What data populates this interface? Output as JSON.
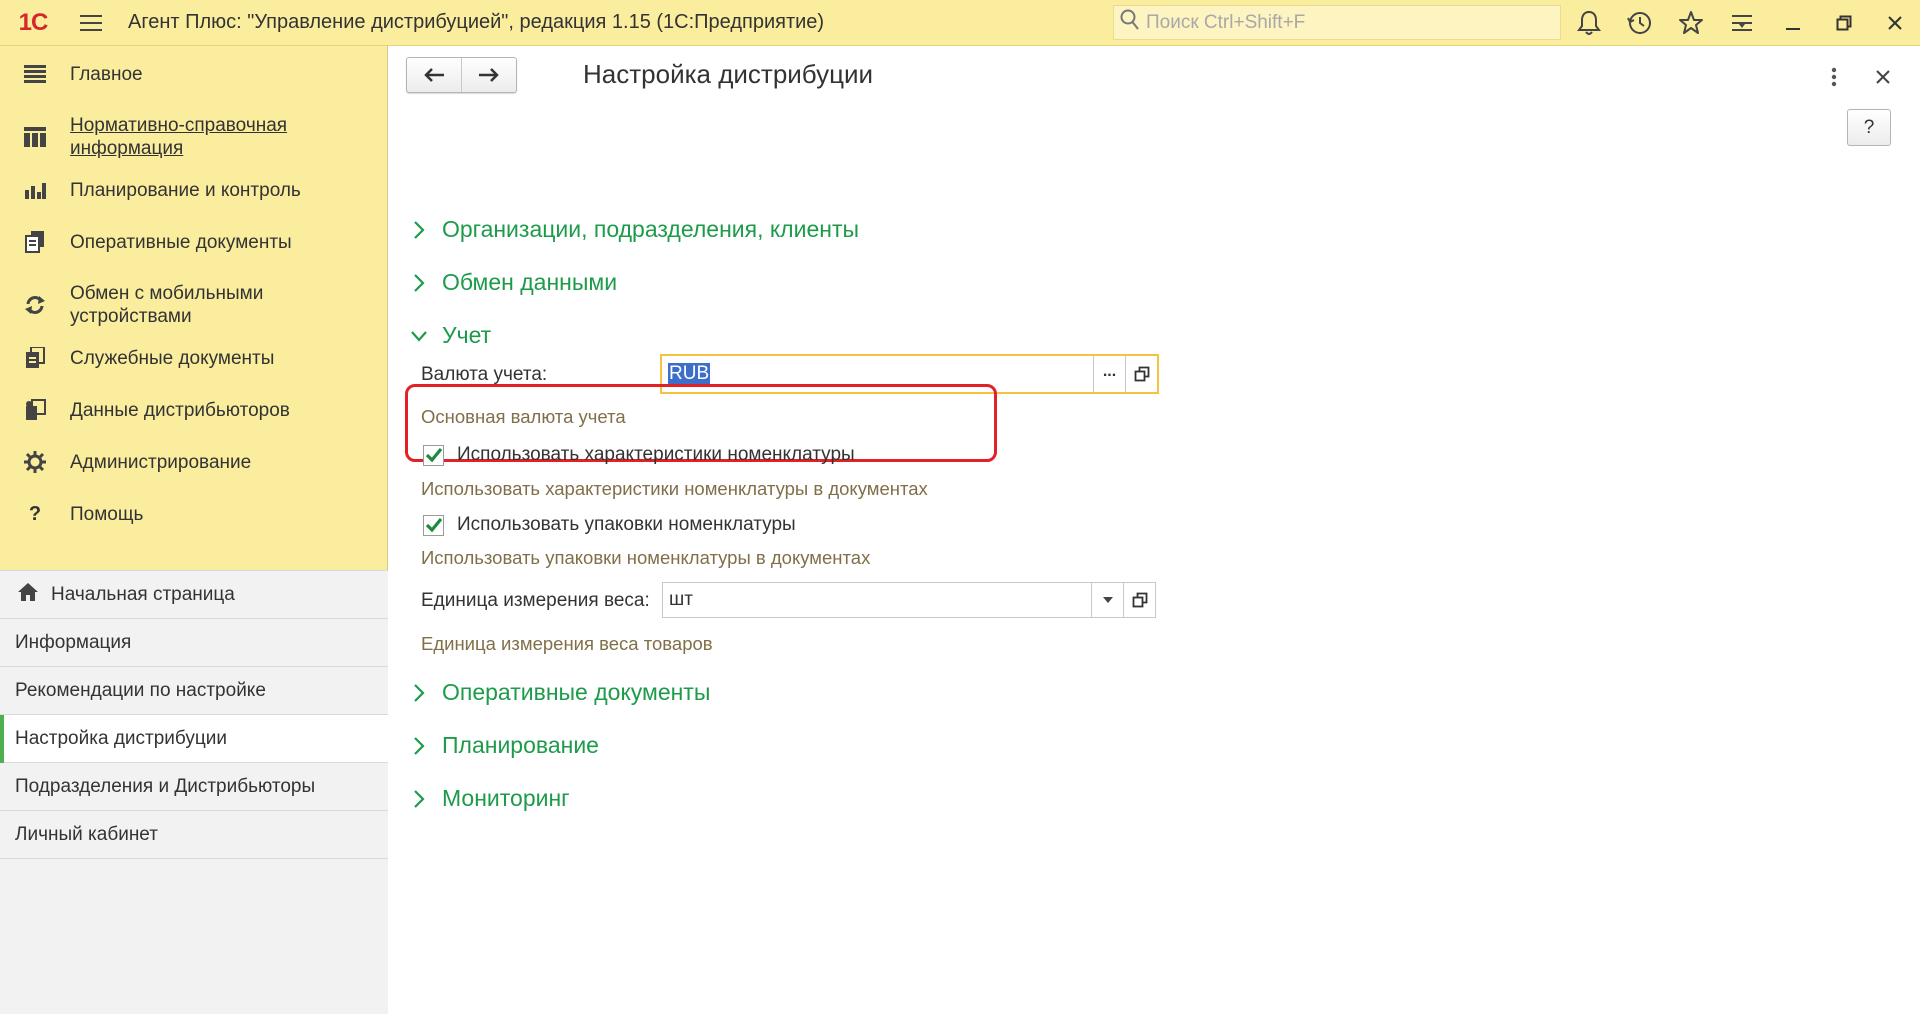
{
  "app": {
    "logo": "1С",
    "title": "Агент Плюс: \"Управление дистрибуцией\", редакция 1.15  (1С:Предприятие)",
    "search_placeholder": "Поиск Ctrl+Shift+F"
  },
  "sections": [
    {
      "label": "Главное",
      "icon": "list-icon"
    },
    {
      "label": "Нормативно-справочная информация",
      "icon": "catalog-icon"
    },
    {
      "label": "Планирование и контроль",
      "icon": "chart-icon"
    },
    {
      "label": "Оперативные документы",
      "icon": "documents-icon"
    },
    {
      "label": "Обмен с мобильными устройствами",
      "icon": "sync-icon"
    },
    {
      "label": "Служебные документы",
      "icon": "service-docs-icon"
    },
    {
      "label": "Данные дистрибьюторов",
      "icon": "distributor-icon"
    },
    {
      "label": "Администрирование",
      "icon": "gear-icon"
    },
    {
      "label": "Помощь",
      "icon": "question-icon"
    }
  ],
  "open_windows": [
    {
      "label": "Начальная страница"
    },
    {
      "label": "Информация"
    },
    {
      "label": "Рекомендации по настройке"
    },
    {
      "label": "Настройка дистрибуции"
    },
    {
      "label": "Подразделения и Дистрибьюторы"
    },
    {
      "label": "Личный кабинет"
    }
  ],
  "form": {
    "title": "Настройка дистрибуции",
    "help_label": "?",
    "groups": {
      "orgs": "Организации, подразделения, клиенты",
      "exchange": "Обмен данными",
      "accounting": "Учет",
      "operative": "Оперативные документы",
      "planning": "Планирование",
      "monitoring": "Мониторинг"
    },
    "currency": {
      "label": "Валюта учета:",
      "value": "RUB",
      "hint": "Основная валюта учета",
      "select_btn": "..."
    },
    "use_characteristics": {
      "label": "Использовать характеристики номенклатуры",
      "checked": true,
      "hint": "Использовать характеристики номенклатуры в документах"
    },
    "use_packages": {
      "label": "Использовать упаковки номенклатуры",
      "checked": true,
      "hint": "Использовать упаковки номенклатуры в документах"
    },
    "weight_unit": {
      "label": "Единица измерения веса:",
      "value": "шт",
      "hint": "Единица измерения веса товаров"
    }
  },
  "colors": {
    "titlebar": "#fbed9e",
    "group_green": "#1d9b4a",
    "highlight_red": "#e32026",
    "focus_border": "#f5c242"
  }
}
